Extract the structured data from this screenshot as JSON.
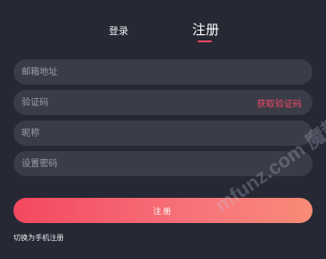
{
  "tabs": {
    "login": "登录",
    "register": "注册",
    "active": "register"
  },
  "form": {
    "email_placeholder": "邮箱地址",
    "code_placeholder": "验证码",
    "get_code_label": "获取验证码",
    "nickname_placeholder": "昵称",
    "password_placeholder": "设置密码",
    "submit_label": "注册",
    "switch_label": "切换为手机注册"
  },
  "watermark": {
    "text": "mfunz.com 魔趣网"
  },
  "colors": {
    "background": "#262834",
    "field": "#3a3c48",
    "accent": "#f24a63",
    "button_gradient_start": "#f3485f",
    "button_gradient_end": "#f98b78"
  }
}
